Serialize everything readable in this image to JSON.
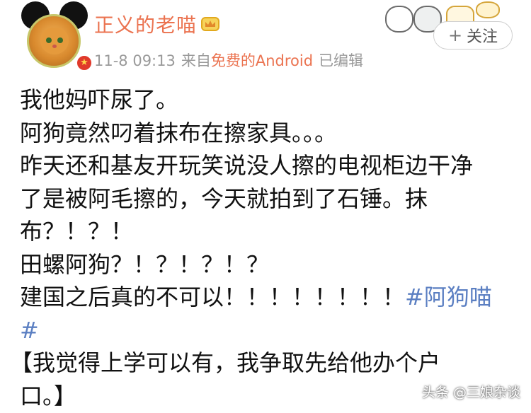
{
  "post": {
    "author": "正义的老喵",
    "time": "11-8 09:13",
    "via": "来自",
    "source": "免费的Android",
    "edited": "已编辑",
    "follow_label": "关注",
    "content": {
      "l1": "我他妈吓尿了。",
      "l2": "阿狗竟然叼着抹布在擦家具。。。",
      "l3": "昨天还和基友开玩笑说没人擦的电视柜边干净",
      "l4": "了是被阿毛擦的，今天就拍到了石锤。抹",
      "l5": "布？！？！",
      "l6": "田螺阿狗？！？！？！？",
      "l7_text": "建国之后真的不可以！！！！！！！！",
      "l7_tag": "#阿狗喵",
      "l8_tag": "#",
      "l9": "【我觉得上学可以有，我争取先给他办个户",
      "l10": "口。】"
    }
  },
  "watermark": "头条 @三娘杂谈",
  "colors": {
    "name": "#eb7350",
    "hashtag": "#5b7fc2",
    "meta": "#9a9a9a"
  }
}
